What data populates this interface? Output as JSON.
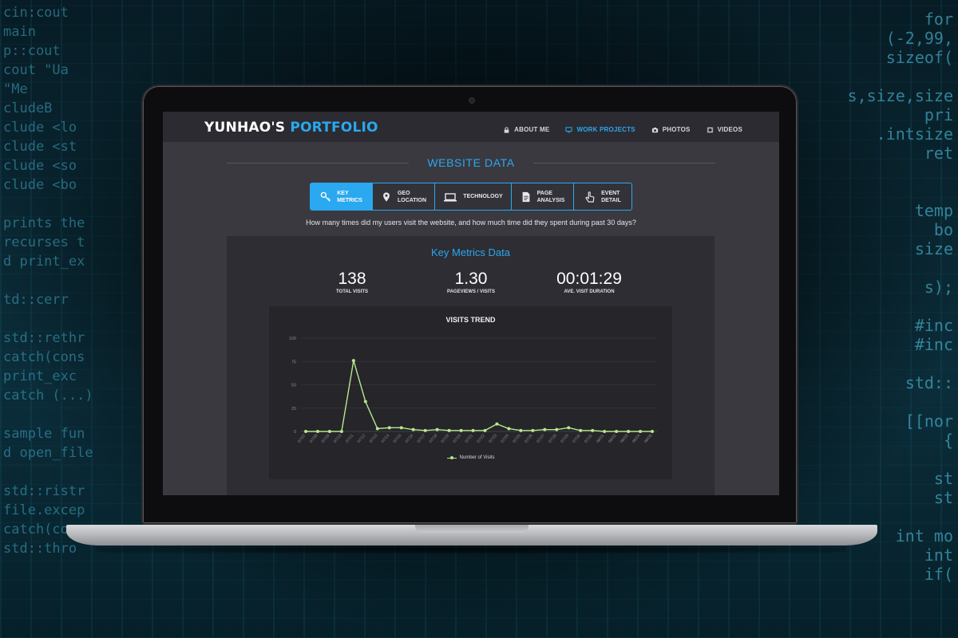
{
  "brand": {
    "title_part1": "YUNHAO'S",
    "title_part2": "PORTFOLIO",
    "accent_color": "#2aa8f0"
  },
  "nav": {
    "items": [
      {
        "label": "ABOUT ME",
        "icon": "lock-icon",
        "active": false
      },
      {
        "label": "WORK PROJECTS",
        "icon": "monitor-icon",
        "active": true
      },
      {
        "label": "PHOTOS",
        "icon": "camera-icon",
        "active": false
      },
      {
        "label": "VIDEOS",
        "icon": "film-icon",
        "active": false
      }
    ]
  },
  "section": {
    "title": "WEBSITE DATA"
  },
  "tabs": [
    {
      "line1": "KEY",
      "line2": "METRICS",
      "icon": "key-icon",
      "active": true
    },
    {
      "line1": "GEO",
      "line2": "LOCATION",
      "icon": "map-pin-icon",
      "active": false
    },
    {
      "line1": "TECHNOLOGY",
      "line2": "",
      "icon": "laptop-icon",
      "active": false
    },
    {
      "line1": "PAGE",
      "line2": "ANALYSIS",
      "icon": "document-icon",
      "active": false
    },
    {
      "line1": "EVENT",
      "line2": "DETAIL",
      "icon": "pointer-hand-icon",
      "active": false
    }
  ],
  "question": "How many times did my users visit the website, and how much time did they spent during past 30 days?",
  "panel": {
    "title": "Key Metrics Data"
  },
  "metrics": [
    {
      "value": "138",
      "label": "TOTAL VISITS"
    },
    {
      "value": "1.30",
      "label": "PAGEVIEWS / VISITS"
    },
    {
      "value": "00:01:29",
      "label": "AVE. VISIT DURATION"
    }
  ],
  "chart_data": {
    "type": "line",
    "title": "VISITS TREND",
    "x": [
      "07/07",
      "07/08",
      "07/09",
      "07/10",
      "07/11",
      "07/12",
      "07/13",
      "07/14",
      "07/15",
      "07/16",
      "07/17",
      "07/18",
      "07/19",
      "07/20",
      "07/21",
      "07/22",
      "07/23",
      "07/24",
      "07/25",
      "07/26",
      "07/27",
      "07/28",
      "07/29",
      "07/30",
      "07/31",
      "08/01",
      "08/02",
      "08/03",
      "08/04",
      "08/05"
    ],
    "series": [
      {
        "name": "Number of Visits",
        "color": "#b6e88c",
        "values": [
          0,
          0,
          0,
          0,
          76,
          32,
          3,
          4,
          4,
          2,
          1,
          2,
          1,
          1,
          1,
          1,
          8,
          3,
          1,
          1,
          2,
          2,
          4,
          1,
          1,
          0,
          0,
          0,
          0,
          0
        ]
      }
    ],
    "ylim": [
      0,
      100
    ],
    "yticks": [
      0,
      25,
      50,
      75,
      100
    ],
    "grid": true,
    "legend": "bottom"
  }
}
